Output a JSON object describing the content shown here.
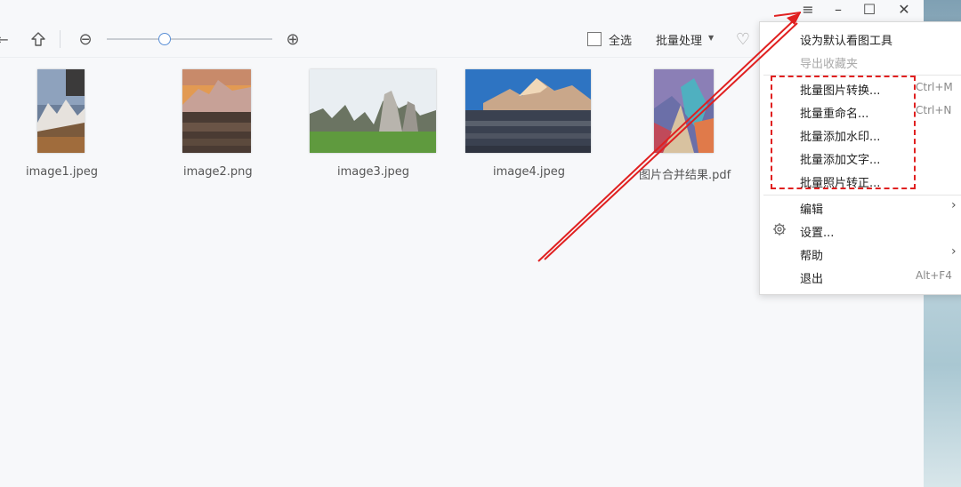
{
  "window": {
    "menu_icon": "≡",
    "minimize_icon": "–",
    "maximize_icon": "☐",
    "close_icon": "✕"
  },
  "toolbar": {
    "back_icon": "←",
    "up_icon": "up-arrow-icon",
    "zoom_out_icon": "⊖",
    "zoom_in_icon": "⊕",
    "zoom_level": 0.35,
    "select_all_label": "全选",
    "batch_label": "批量处理",
    "favorite_icon": "♡"
  },
  "files": [
    {
      "name": "image1.jpeg"
    },
    {
      "name": "image2.png"
    },
    {
      "name": "image3.jpeg"
    },
    {
      "name": "image4.jpeg"
    },
    {
      "name": "图片合并结果.pdf"
    }
  ],
  "menu": {
    "items": [
      {
        "label": "设为默认看图工具",
        "shortcut": "",
        "disabled": false
      },
      {
        "label": "导出收藏夹",
        "shortcut": "",
        "disabled": true
      },
      {
        "label": "批量图片转换...",
        "shortcut": "Ctrl+M",
        "disabled": false
      },
      {
        "label": "批量重命名...",
        "shortcut": "Ctrl+N",
        "disabled": false
      },
      {
        "label": "批量添加水印...",
        "shortcut": "",
        "disabled": false
      },
      {
        "label": "批量添加文字...",
        "shortcut": "",
        "disabled": false
      },
      {
        "label": "批量照片转正...",
        "shortcut": "",
        "disabled": false
      },
      {
        "label": "编辑",
        "shortcut": "",
        "submenu": true
      },
      {
        "label": "设置...",
        "shortcut": "",
        "icon": "gear-icon"
      },
      {
        "label": "帮助",
        "shortcut": "",
        "submenu": true
      },
      {
        "label": "退出",
        "shortcut": "Alt+F4"
      }
    ]
  },
  "colors": {
    "annotation": "#e02020",
    "accent": "#5a8fd6"
  }
}
